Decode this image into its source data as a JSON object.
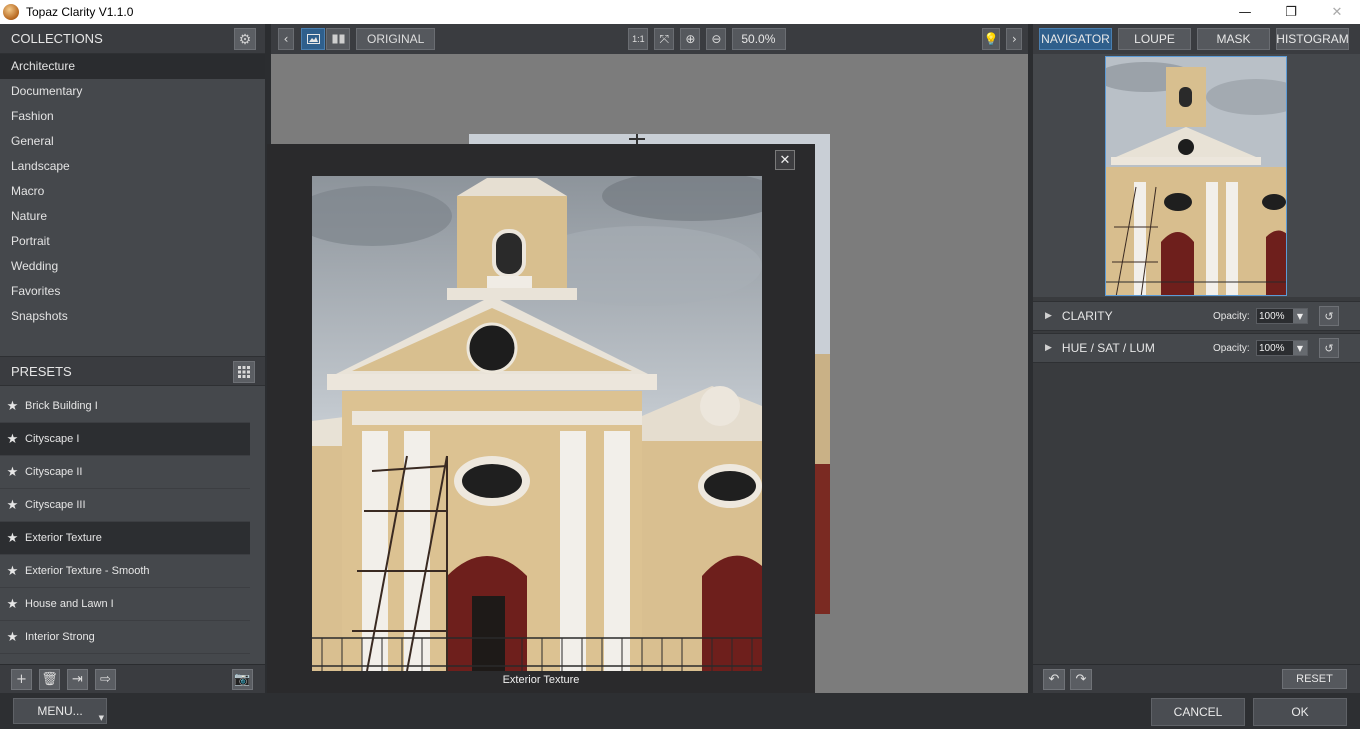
{
  "window": {
    "title": "Topaz Clarity V1.1.0",
    "min": "—",
    "max": "❐",
    "close": "✕"
  },
  "collections": {
    "header": "COLLECTIONS",
    "items": [
      {
        "label": "Architecture",
        "active": true
      },
      {
        "label": "Documentary"
      },
      {
        "label": "Fashion"
      },
      {
        "label": "General"
      },
      {
        "label": "Landscape"
      },
      {
        "label": "Macro"
      },
      {
        "label": "Nature"
      },
      {
        "label": "Portrait"
      },
      {
        "label": "Wedding"
      },
      {
        "label": "Favorites"
      },
      {
        "label": "Snapshots"
      }
    ]
  },
  "presets": {
    "header": "PRESETS",
    "items": [
      {
        "label": "Brick Building I"
      },
      {
        "label": "Cityscape I",
        "active": true
      },
      {
        "label": "Cityscape II"
      },
      {
        "label": "Cityscape III"
      },
      {
        "label": "Exterior Texture",
        "active": true
      },
      {
        "label": "Exterior Texture - Smooth"
      },
      {
        "label": "House and Lawn I"
      },
      {
        "label": "Interior Strong"
      }
    ]
  },
  "toolbar": {
    "original_label": "ORIGINAL",
    "one_to_one": "1:1",
    "zoom": "50.0%"
  },
  "preview_dialog": {
    "caption": "Exterior Texture"
  },
  "right_tabs": [
    "NAVIGATOR",
    "LOUPE",
    "MASK",
    "HISTOGRAM"
  ],
  "adjustments": [
    {
      "label": "CLARITY",
      "opacity_label": "Opacity:",
      "opacity": "100%"
    },
    {
      "label": "HUE / SAT / LUM",
      "opacity_label": "Opacity:",
      "opacity": "100%"
    }
  ],
  "right_bottom": {
    "reset_label": "RESET"
  },
  "bottom": {
    "menu_label": "MENU...",
    "cancel_label": "CANCEL",
    "ok_label": "OK"
  },
  "colors": {
    "accent": "#2f5f8c",
    "panel": "#45484c",
    "canvas": "#7c7c7c"
  }
}
